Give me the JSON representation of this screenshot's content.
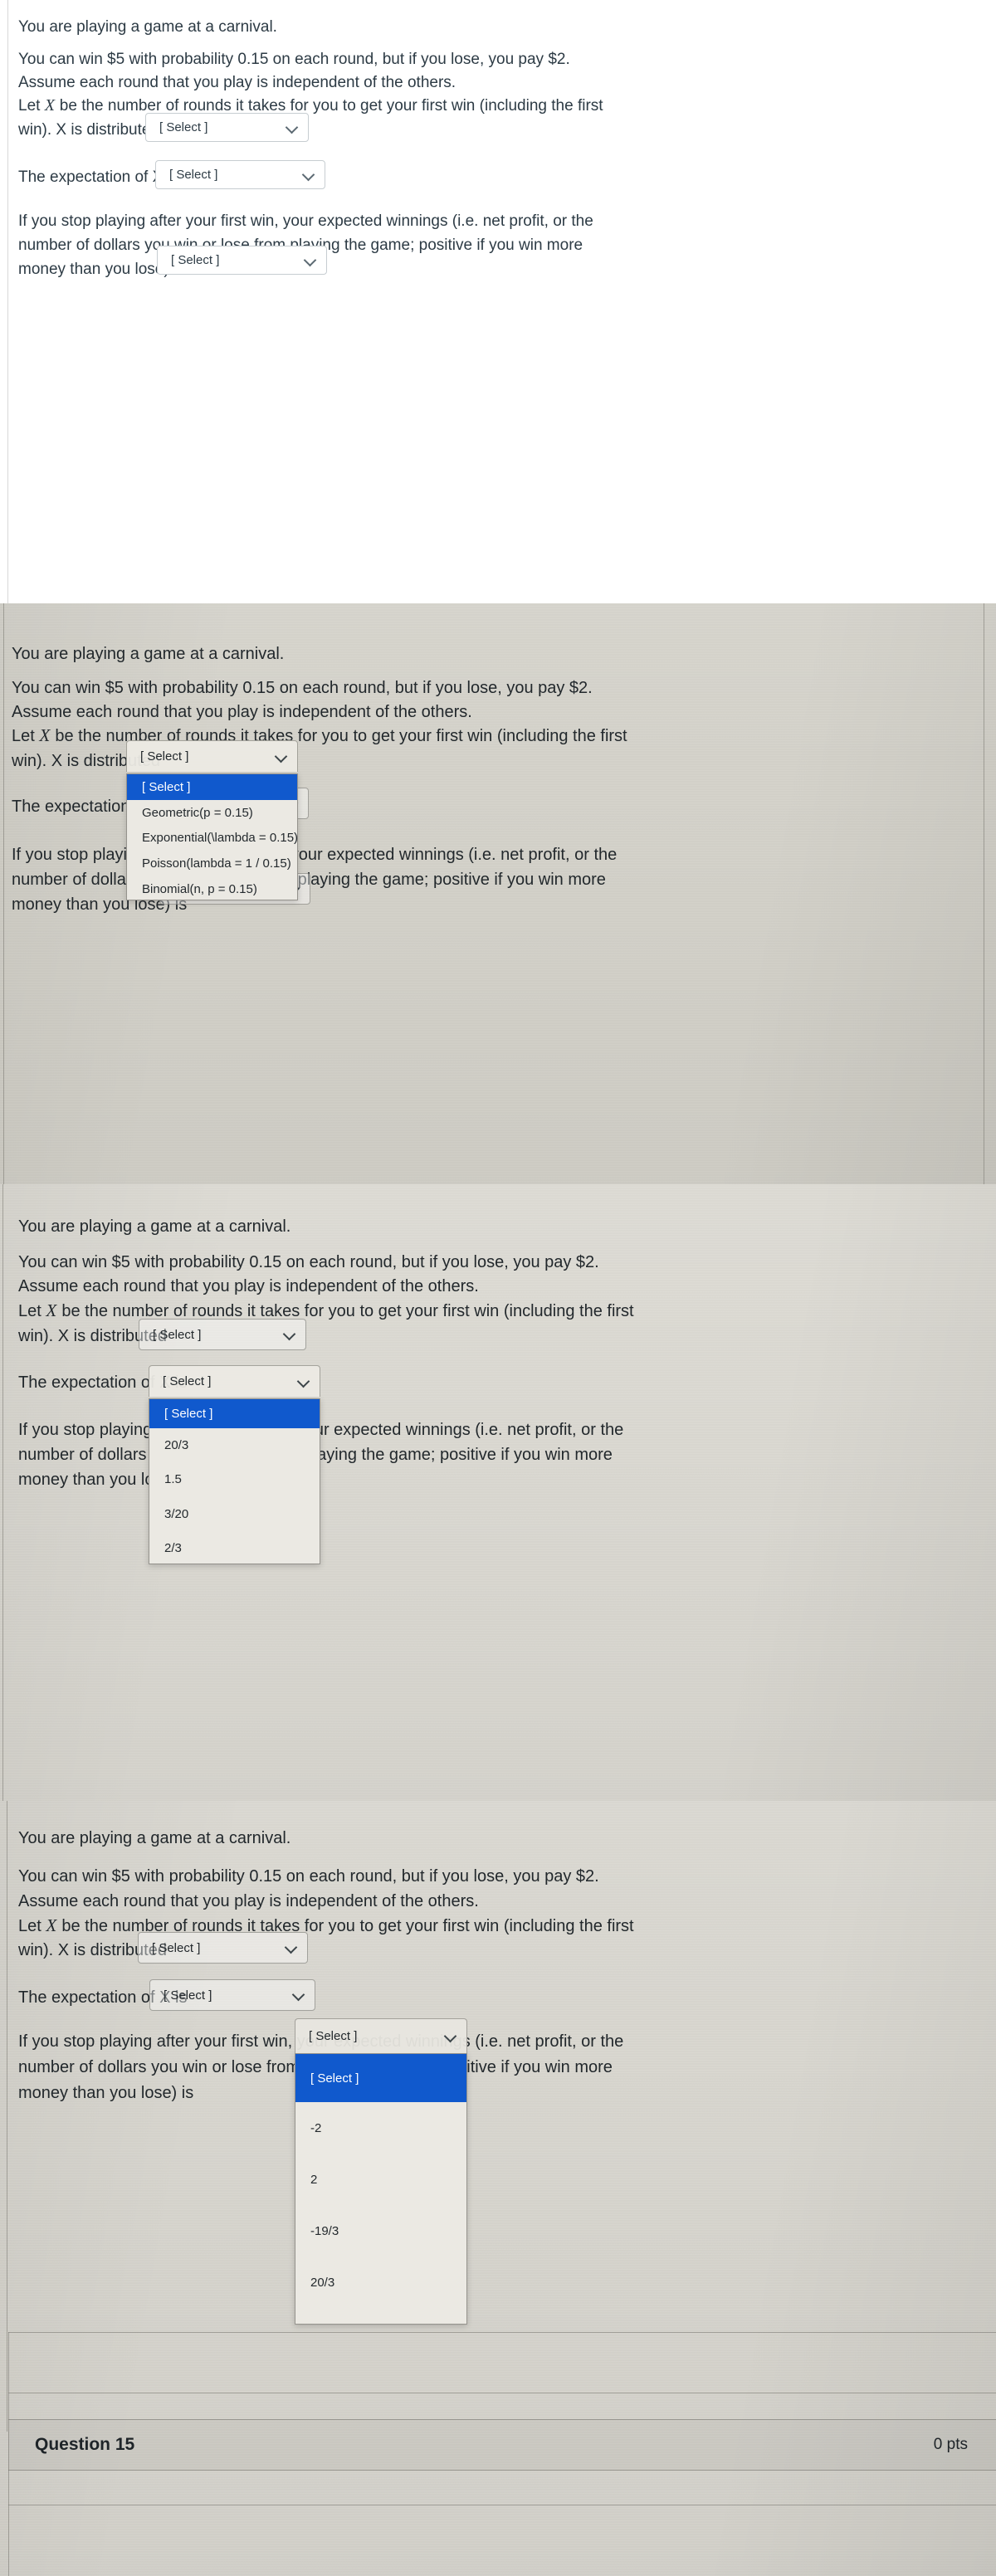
{
  "question": {
    "intro": "You are playing a game at a carnival.",
    "para2_line1": "You can win $5 with probability 0.15 on each round, but if you lose, you pay $2.",
    "para2_line2": "Assume each round that you play is independent of the others.",
    "para3_prefix": "Let ",
    "para3_var": "X",
    "para3_line1": " be the number of rounds it takes for you to get your first win (including the first",
    "para3_line2": "win).  X is distributed",
    "para4_label": "The expectation of X is",
    "para5_line1": "If you stop playing after your first win, your expected winnings (i.e. net profit, or the",
    "para5_line2": "number of dollars you win or lose from playing the game; positive if you win more",
    "para5_line3": "money than you lose) is"
  },
  "select_placeholder": "[ Select ]",
  "dropdowns": {
    "distribution": {
      "name": "distribution-select",
      "value": "[ Select ]",
      "options": [
        "[ Select ]",
        "Geometric(p = 0.15)",
        "Exponential(\\lambda = 0.15)",
        "Poisson(lambda = 1 / 0.15)",
        "Binomial(n, p = 0.15)"
      ],
      "selected_index": 0
    },
    "expectation": {
      "name": "expectation-select",
      "value": "[ Select ]",
      "options": [
        "[ Select ]",
        "20/3",
        "1.5",
        "3/20",
        "2/3"
      ],
      "selected_index": 0
    },
    "winnings": {
      "name": "winnings-select",
      "value": "[ Select ]",
      "options": [
        "[ Select ]",
        "-2",
        "2",
        "-19/3",
        "20/3"
      ],
      "selected_index": 0
    }
  },
  "quiz_row": {
    "question_label": "Question 15",
    "points_label": "0 pts"
  },
  "colors": {
    "highlight": "#1059cd",
    "text": "#2d3b45",
    "select_border": "#c7cdd1",
    "menu_bg": "#ebe9e3"
  }
}
